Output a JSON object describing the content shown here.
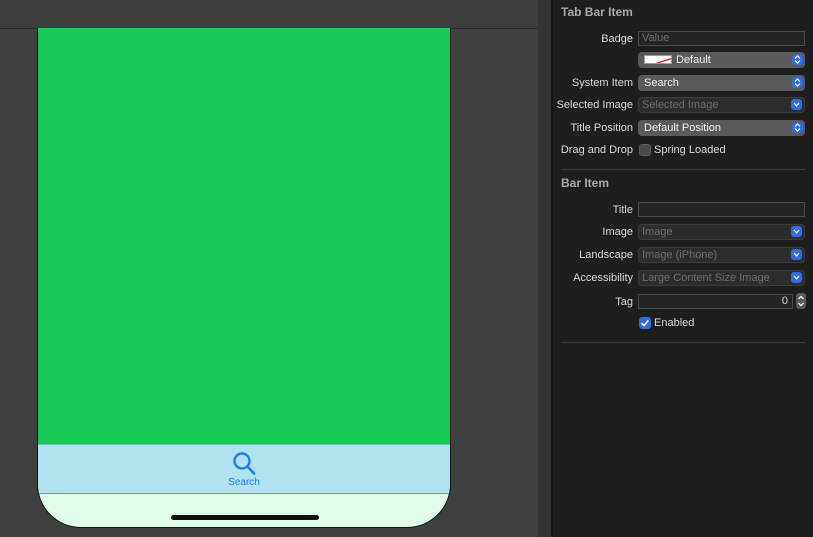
{
  "device": {
    "tab_item_label": "Search",
    "screen_color": "#19c957",
    "tabbar_color": "#b0e3ef",
    "accent_color": "#1e7cf0",
    "icon": "magnifying-glass-icon"
  },
  "inspector": {
    "tab_bar_item": {
      "title": "Tab Bar Item",
      "badge": {
        "label": "Badge",
        "placeholder": "Value"
      },
      "badge_color": {
        "value": "Default"
      },
      "system_item": {
        "label": "System Item",
        "value": "Search"
      },
      "selected_image": {
        "label": "Selected Image",
        "value": "Selected Image"
      },
      "title_position": {
        "label": "Title Position",
        "value": "Default Position"
      },
      "drag_and_drop": {
        "label": "Drag and Drop",
        "option": "Spring Loaded",
        "checked": false
      }
    },
    "bar_item": {
      "title": "Bar Item",
      "title_field": {
        "label": "Title",
        "value": ""
      },
      "image": {
        "label": "Image",
        "value": "Image"
      },
      "landscape": {
        "label": "Landscape",
        "value": "Image (iPhone)"
      },
      "accessibility": {
        "label": "Accessibility",
        "value": "Large Content Size Image"
      },
      "tag": {
        "label": "Tag",
        "value": "0"
      },
      "enabled": {
        "label": "Enabled",
        "checked": true
      }
    }
  }
}
